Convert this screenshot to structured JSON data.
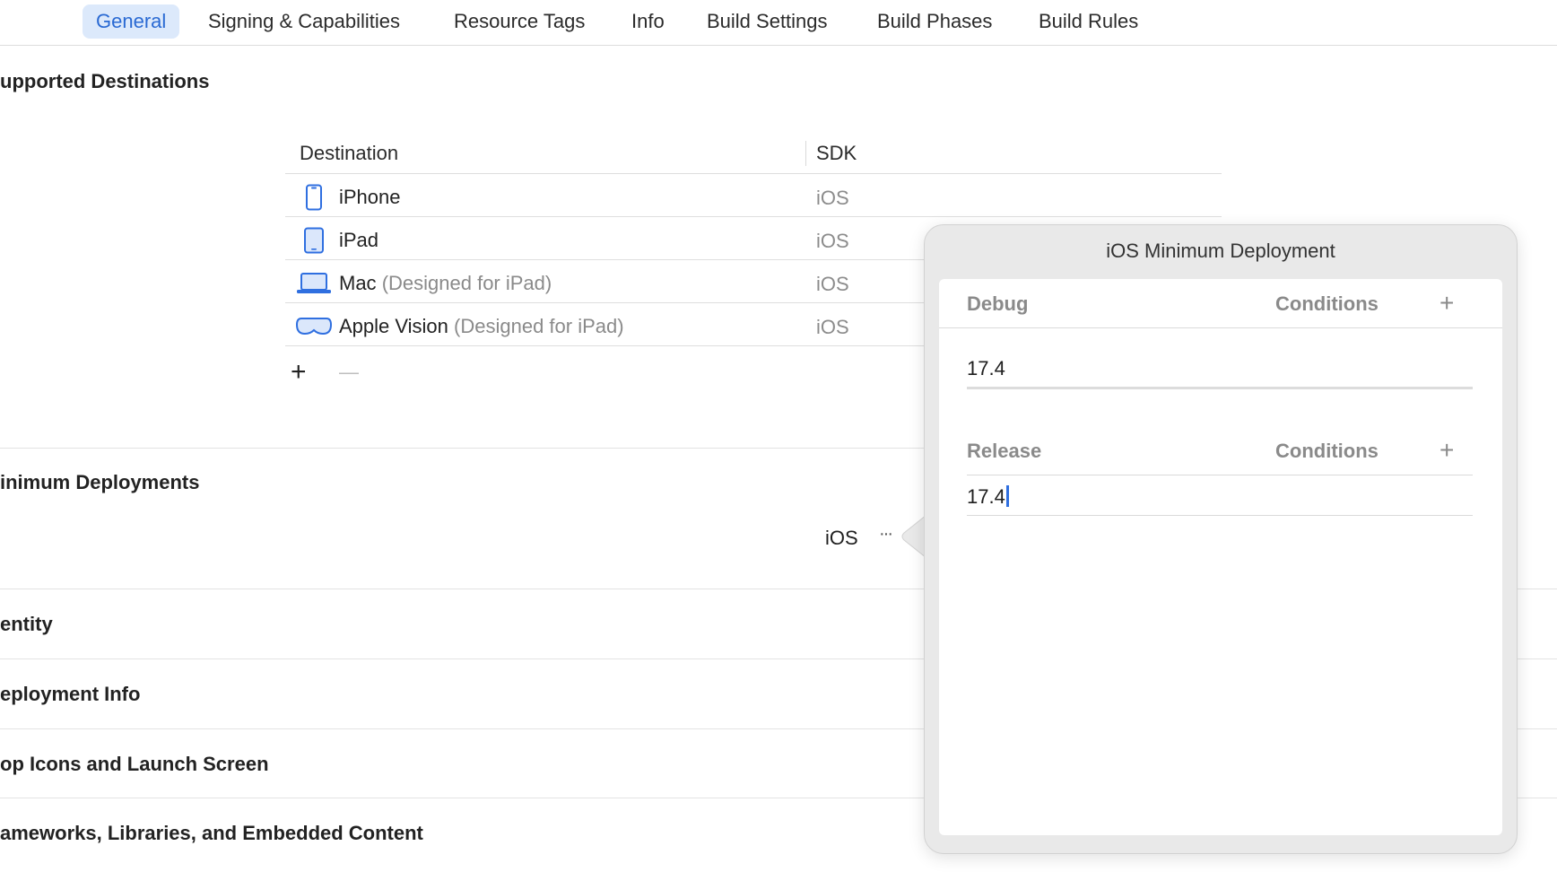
{
  "tabs": [
    {
      "label": "General",
      "active": true
    },
    {
      "label": "Signing & Capabilities"
    },
    {
      "label": "Resource Tags"
    },
    {
      "label": "Info"
    },
    {
      "label": "Build Settings"
    },
    {
      "label": "Build Phases"
    },
    {
      "label": "Build Rules"
    }
  ],
  "supported_destinations": {
    "title": "upported Destinations",
    "columns": {
      "destination": "Destination",
      "sdk": "SDK"
    },
    "rows": [
      {
        "name": "iPhone",
        "note": "",
        "sdk": "iOS",
        "icon": "iphone-icon"
      },
      {
        "name": "iPad",
        "note": "",
        "sdk": "iOS",
        "icon": "ipad-icon"
      },
      {
        "name": "Mac",
        "note": "(Designed for iPad)",
        "sdk": "iOS",
        "icon": "laptop-icon"
      },
      {
        "name": "Apple Vision",
        "note": "(Designed for iPad)",
        "sdk": "iOS",
        "icon": "vision-headset-icon"
      }
    ],
    "add_symbol": "+",
    "remove_symbol": "—"
  },
  "minimum_deployments": {
    "title": "inimum Deployments",
    "platform": "iOS",
    "more_symbol": "···"
  },
  "sections": [
    {
      "title": "entity"
    },
    {
      "title": "eployment Info"
    },
    {
      "title": "op Icons and Launch Screen"
    },
    {
      "title": "ameworks, Libraries, and Embedded Content"
    }
  ],
  "popover": {
    "title": "iOS Minimum Deployment",
    "debug": {
      "label": "Debug",
      "conditions": "Conditions",
      "add": "+",
      "value": "17.4"
    },
    "release": {
      "label": "Release",
      "conditions": "Conditions",
      "add": "+",
      "value": "17.4"
    }
  },
  "colors": {
    "accent": "#2a6ad3",
    "icon_blue": "#2f6fe0",
    "secondary_text": "#8a8a8a"
  }
}
